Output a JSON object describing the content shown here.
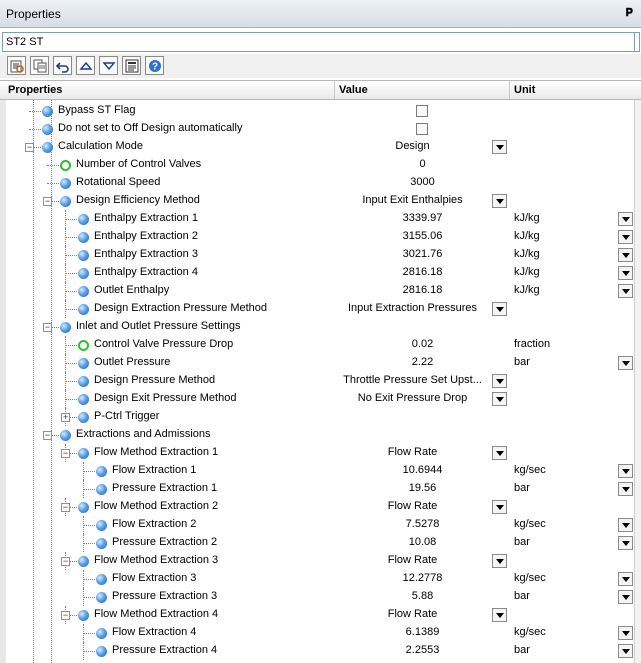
{
  "title": "Properties",
  "pin": "p",
  "object_name": "ST2 ST",
  "toolbar": [
    "properties-icon",
    "copy-icon",
    "undo-icon",
    "up-arrow-icon",
    "down-arrow-icon",
    "report-icon",
    "help-icon"
  ],
  "columns": {
    "properties": "Properties",
    "value": "Value",
    "unit": "Unit"
  },
  "rows": [
    {
      "label": "Bypass ST Flag",
      "value": "",
      "unit": "",
      "level": 1,
      "icon": "ball",
      "checkbox": true
    },
    {
      "label": "Do not set to Off Design automatically",
      "value": "",
      "unit": "",
      "level": 1,
      "icon": "ball",
      "checkbox": true
    },
    {
      "label": "Calculation Mode",
      "value": "Design",
      "unit": "",
      "level": 1,
      "icon": "ball",
      "expander": "-",
      "dropdown": true
    },
    {
      "label": "Number of Control Valves",
      "value": "0",
      "unit": "",
      "level": 2,
      "icon": "ring"
    },
    {
      "label": "Rotational Speed",
      "value": "3000",
      "unit": "",
      "level": 2,
      "icon": "ball"
    },
    {
      "label": "Design Efficiency Method",
      "value": "Input Exit Enthalpies",
      "unit": "",
      "level": 2,
      "icon": "ball",
      "expander": "-",
      "dropdown": true
    },
    {
      "label": "Enthalpy Extraction 1",
      "value": "3339.97",
      "unit": "kJ/kg",
      "level": 3,
      "icon": "ball",
      "unitdd": true
    },
    {
      "label": "Enthalpy Extraction 2",
      "value": "3155.06",
      "unit": "kJ/kg",
      "level": 3,
      "icon": "ball",
      "unitdd": true
    },
    {
      "label": "Enthalpy Extraction 3",
      "value": "3021.76",
      "unit": "kJ/kg",
      "level": 3,
      "icon": "ball",
      "unitdd": true
    },
    {
      "label": "Enthalpy Extraction 4",
      "value": "2816.18",
      "unit": "kJ/kg",
      "level": 3,
      "icon": "ball",
      "unitdd": true
    },
    {
      "label": "Outlet Enthalpy",
      "value": "2816.18",
      "unit": "kJ/kg",
      "level": 3,
      "icon": "ball",
      "unitdd": true
    },
    {
      "label": "Design Extraction Pressure Method",
      "value": "Input Extraction Pressures",
      "unit": "",
      "level": 3,
      "icon": "ball",
      "dropdown": true
    },
    {
      "label": "Inlet and Outlet Pressure Settings",
      "value": "",
      "unit": "",
      "level": 2,
      "icon": "ball",
      "expander": "-"
    },
    {
      "label": "Control Valve Pressure Drop",
      "value": "0.02",
      "unit": "fraction",
      "level": 3,
      "icon": "ring"
    },
    {
      "label": "Outlet Pressure",
      "value": "2.22",
      "unit": "bar",
      "level": 3,
      "icon": "ball",
      "unitdd": true
    },
    {
      "label": "Design Pressure Method",
      "value": "Throttle Pressure Set Upst...",
      "unit": "",
      "level": 3,
      "icon": "ball",
      "dropdown": true
    },
    {
      "label": "Design Exit Pressure Method",
      "value": "No Exit Pressure Drop",
      "unit": "",
      "level": 3,
      "icon": "ball",
      "dropdown": true
    },
    {
      "label": "P-Ctrl Trigger",
      "value": "",
      "unit": "",
      "level": 3,
      "icon": "ball",
      "expander": "+"
    },
    {
      "label": "Extractions and Admissions",
      "value": "",
      "unit": "",
      "level": 2,
      "icon": "ball",
      "expander": "-"
    },
    {
      "label": "Flow Method Extraction 1",
      "value": "Flow Rate",
      "unit": "",
      "level": 3,
      "icon": "ball",
      "expander": "-",
      "dropdown": true
    },
    {
      "label": "Flow Extraction 1",
      "value": "10.6944",
      "unit": "kg/sec",
      "level": 4,
      "icon": "ball",
      "unitdd": true
    },
    {
      "label": "Pressure Extraction 1",
      "value": "19.56",
      "unit": "bar",
      "level": 4,
      "icon": "ball",
      "unitdd": true
    },
    {
      "label": "Flow Method Extraction 2",
      "value": "Flow Rate",
      "unit": "",
      "level": 3,
      "icon": "ball",
      "expander": "-",
      "dropdown": true
    },
    {
      "label": "Flow Extraction 2",
      "value": "7.5278",
      "unit": "kg/sec",
      "level": 4,
      "icon": "ball",
      "unitdd": true
    },
    {
      "label": "Pressure Extraction 2",
      "value": "10.08",
      "unit": "bar",
      "level": 4,
      "icon": "ball",
      "unitdd": true
    },
    {
      "label": "Flow Method Extraction 3",
      "value": "Flow Rate",
      "unit": "",
      "level": 3,
      "icon": "ball",
      "expander": "-",
      "dropdown": true
    },
    {
      "label": "Flow Extraction 3",
      "value": "12.2778",
      "unit": "kg/sec",
      "level": 4,
      "icon": "ball",
      "unitdd": true
    },
    {
      "label": "Pressure Extraction 3",
      "value": "5.88",
      "unit": "bar",
      "level": 4,
      "icon": "ball",
      "unitdd": true
    },
    {
      "label": "Flow Method Extraction 4",
      "value": "Flow Rate",
      "unit": "",
      "level": 3,
      "icon": "ball",
      "expander": "-",
      "dropdown": true
    },
    {
      "label": "Flow Extraction 4",
      "value": "6.1389",
      "unit": "kg/sec",
      "level": 4,
      "icon": "ball",
      "unitdd": true
    },
    {
      "label": "Pressure Extraction 4",
      "value": "2.2553",
      "unit": "bar",
      "level": 4,
      "icon": "ball",
      "unitdd": true
    }
  ]
}
